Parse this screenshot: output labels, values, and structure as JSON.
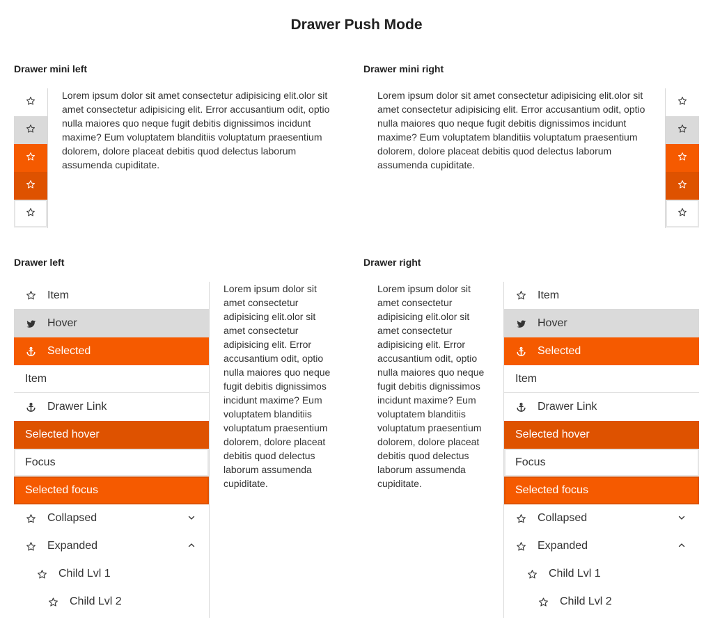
{
  "page": {
    "title": "Drawer Push Mode"
  },
  "mini_left": {
    "title": "Drawer mini left",
    "items": [
      {
        "icon": "star-icon",
        "state": "default"
      },
      {
        "icon": "star-icon",
        "state": "hover"
      },
      {
        "icon": "star-icon",
        "state": "selected"
      },
      {
        "icon": "star-icon",
        "state": "selected-hover"
      },
      {
        "icon": "star-icon",
        "state": "focus"
      }
    ],
    "text": "Lorem ipsum dolor sit amet consectetur adipisicing elit.olor sit amet consectetur adipisicing elit. Error accusantium odit, optio nulla maiores quo neque fugit debitis dignissimos incidunt maxime? Eum voluptatem blanditiis voluptatum praesentium dolorem, dolore placeat debitis quod delectus laborum assumenda cupiditate."
  },
  "mini_right": {
    "title": "Drawer mini right",
    "items": [
      {
        "icon": "star-icon",
        "state": "default"
      },
      {
        "icon": "star-icon",
        "state": "hover"
      },
      {
        "icon": "star-icon",
        "state": "selected"
      },
      {
        "icon": "star-icon",
        "state": "selected-hover"
      },
      {
        "icon": "star-icon",
        "state": "focus"
      }
    ],
    "text": "Lorem ipsum dolor sit amet consectetur adipisicing elit.olor sit amet consectetur adipisicing elit. Error accusantium odit, optio nulla maiores quo neque fugit debitis dignissimos incidunt maxime? Eum voluptatem blanditiis voluptatum praesentium dolorem, dolore placeat debitis quod delectus laborum assumenda cupiditate."
  },
  "drawer_left": {
    "title": "Drawer left",
    "items": {
      "item1": "Item",
      "hover": "Hover",
      "selected": "Selected",
      "item2": "Item",
      "link": "Drawer Link",
      "selected_hover": "Selected hover",
      "focus": "Focus",
      "selected_focus": "Selected focus",
      "collapsed": "Collapsed",
      "expanded": "Expanded",
      "child1": "Child Lvl 1",
      "child2": "Child Lvl 2"
    },
    "text": "Lorem ipsum dolor sit amet consectetur adipisicing elit.olor sit amet consectetur adipisicing elit. Error accusantium odit, optio nulla maiores quo neque fugit debitis dignissimos incidunt maxime? Eum voluptatem blanditiis voluptatum praesentium dolorem, dolore placeat debitis quod delectus laborum assumenda cupiditate."
  },
  "drawer_right": {
    "title": "Drawer right",
    "items": {
      "item1": "Item",
      "hover": "Hover",
      "selected": "Selected",
      "item2": "Item",
      "link": "Drawer Link",
      "selected_hover": "Selected hover",
      "focus": "Focus",
      "selected_focus": "Selected focus",
      "collapsed": "Collapsed",
      "expanded": "Expanded",
      "child1": "Child Lvl 1",
      "child2": "Child Lvl 2"
    },
    "text": "Lorem ipsum dolor sit amet consectetur adipisicing elit.olor sit amet consectetur adipisicing elit. Error accusantium odit, optio nulla maiores quo neque fugit debitis dignissimos incidunt maxime? Eum voluptatem blanditiis voluptatum praesentium dolorem, dolore placeat debitis quod delectus laborum assumenda cupiditate."
  },
  "colors": {
    "accent": "#f55a00",
    "accent_dark": "#de5200",
    "hover": "#dadada",
    "border": "#d9d9d9"
  }
}
